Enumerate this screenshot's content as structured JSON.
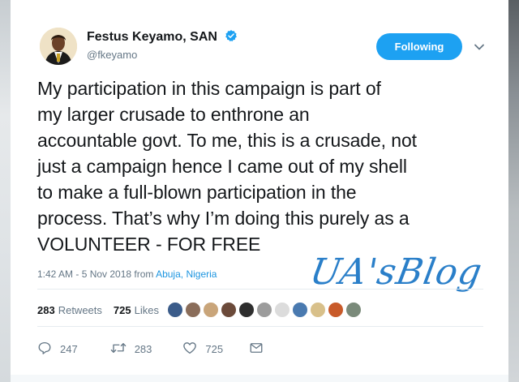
{
  "user": {
    "display_name": "Festus Keyamo, SAN",
    "handle": "@fkeyamo",
    "verified": true
  },
  "follow_button": {
    "label": "Following",
    "color": "#1da1f2"
  },
  "tweet": {
    "lines": [
      "My participation in this campaign is part of",
      "my larger crusade to enthrone an",
      "accountable govt. To me, this is a crusade, not",
      "just a campaign hence I came out of my shell",
      "to make a full-blown participation in the",
      "process. That’s why I’m doing this purely as a",
      "VOLUNTEER - FOR FREE"
    ],
    "timestamp": "1:42 AM - 5 Nov 2018 from",
    "location": "Abuja, Nigeria"
  },
  "watermark": {
    "text": "UA'sBlog"
  },
  "stats": {
    "retweets_count": "283",
    "retweets_label": "Retweets",
    "likes_count": "725",
    "likes_label": "Likes",
    "liker_avatar_colors": [
      "#3b5c8a",
      "#8a6d5a",
      "#c9a57a",
      "#6b4a3a",
      "#2e2e2e",
      "#9c9c9c",
      "#dcdcdc",
      "#4a7ab0",
      "#d8c08a",
      "#c85a2a",
      "#7a8a7a"
    ]
  },
  "actions": {
    "reply_count": "247",
    "retweet_count": "283",
    "like_count": "725"
  },
  "icons": {
    "verified": "verified-badge-icon",
    "chevron": "chevron-down-icon",
    "reply": "reply-icon",
    "retweet": "retweet-icon",
    "like": "heart-icon",
    "message": "direct-message-icon"
  }
}
